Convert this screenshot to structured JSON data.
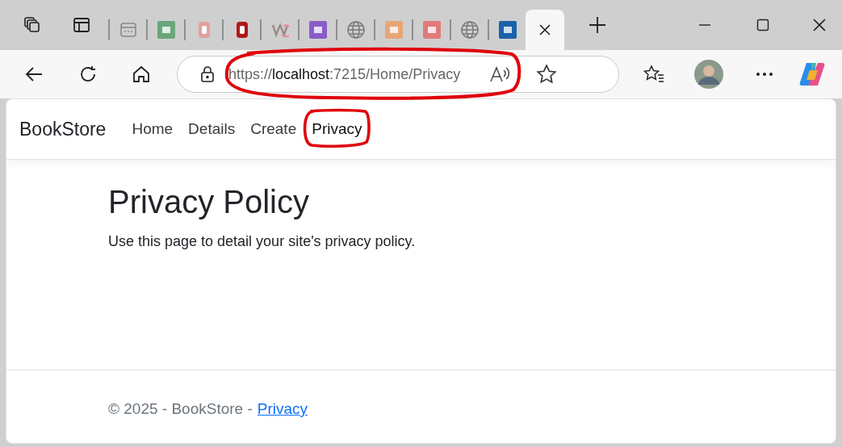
{
  "browser": {
    "tabs": [
      {
        "kind": "grid",
        "color": "#8a8a8a",
        "selected": false
      },
      {
        "kind": "square",
        "color": "#6aa67a",
        "selected": false
      },
      {
        "kind": "ring",
        "color": "#e2a0a0",
        "selected": false
      },
      {
        "kind": "ring",
        "color": "#b01818",
        "selected": false
      },
      {
        "kind": "swirl",
        "color": "#9a8a8a",
        "selected": false
      },
      {
        "kind": "square",
        "color": "#8a5cc8",
        "selected": false
      },
      {
        "kind": "globe",
        "color": "#7a7a7a",
        "selected": false
      },
      {
        "kind": "square",
        "color": "#e8a677",
        "selected": false
      },
      {
        "kind": "square",
        "color": "#e07a7a",
        "selected": false
      },
      {
        "kind": "globe",
        "color": "#7a7a7a",
        "selected": false
      },
      {
        "kind": "square",
        "color": "#1a62a8",
        "selected": false
      },
      {
        "kind": "blank",
        "selected": true
      }
    ],
    "address": {
      "scheme": "https://",
      "host": "localhost",
      "rest": ":7215/Home/Privacy"
    }
  },
  "page": {
    "brand": "BookStore",
    "nav": [
      {
        "label": "Home",
        "selected": false
      },
      {
        "label": "Details",
        "selected": false
      },
      {
        "label": "Create",
        "selected": false
      },
      {
        "label": "Privacy",
        "selected": true
      }
    ],
    "heading": "Privacy Policy",
    "body": "Use this page to detail your site's privacy policy.",
    "footer": {
      "text": "© 2025 - BookStore -",
      "link": "Privacy"
    }
  }
}
